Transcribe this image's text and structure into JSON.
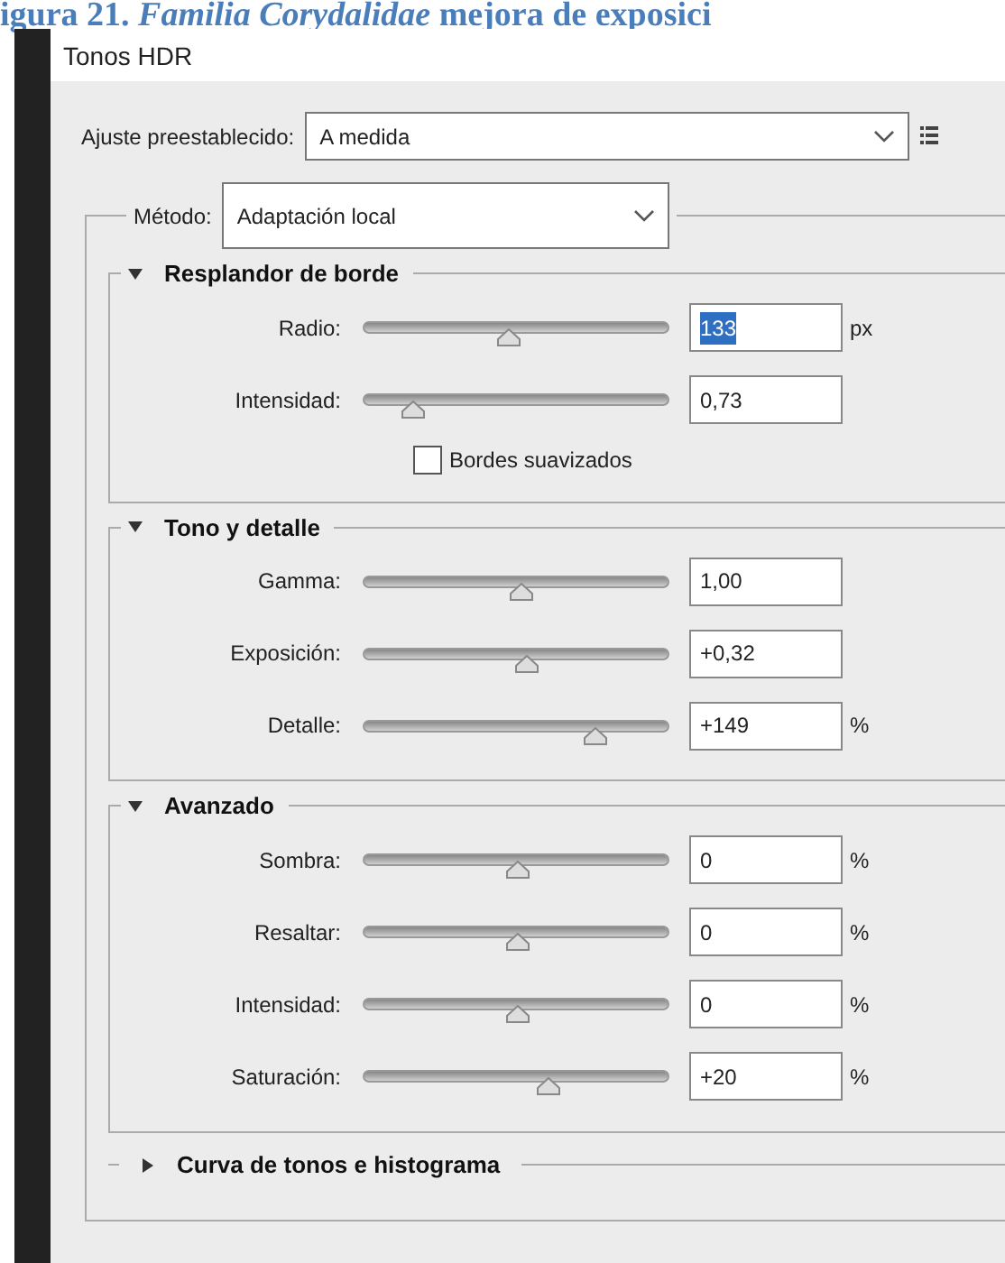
{
  "caption": "igura 21. *Familia Corydalidae* mejora de exposici",
  "window": {
    "title": "Tonos HDR"
  },
  "preset": {
    "label": "Ajuste preestablecido:",
    "value": "A medida"
  },
  "method": {
    "label": "Método:",
    "value": "Adaptación local"
  },
  "sections": [
    {
      "title": "Resplandor de borde",
      "expanded": true,
      "sliders": [
        {
          "label": "Radio:",
          "level": 0.47,
          "value": "133",
          "unit": "px",
          "selected": true
        },
        {
          "label": "Intensidad:",
          "level": 0.16,
          "value": "0,73",
          "selected": false
        }
      ],
      "checkbox": {
        "label": "Bordes suavizados",
        "checked": false
      }
    },
    {
      "title": "Tono y detalle",
      "expanded": true,
      "sliders": [
        {
          "label": "Gamma:",
          "level": 0.51,
          "value": "1,00",
          "selected": false
        },
        {
          "label": "Exposición:",
          "level": 0.53,
          "value": "+0,32",
          "selected": false
        },
        {
          "label": "Detalle:",
          "level": 0.75,
          "value": "+149",
          "unit": "%",
          "selected": false
        }
      ]
    },
    {
      "title": "Avanzado",
      "expanded": true,
      "sliders": [
        {
          "label": "Sombra:",
          "level": 0.5,
          "value": "0",
          "unit": "%",
          "selected": false
        },
        {
          "label": "Resaltar:",
          "level": 0.5,
          "value": "0",
          "unit": "%",
          "selected": false
        },
        {
          "label": "Intensidad:",
          "level": 0.5,
          "value": "0",
          "unit": "%",
          "selected": false
        },
        {
          "label": "Saturación:",
          "level": 0.6,
          "value": "+20",
          "unit": "%",
          "selected": false
        }
      ]
    },
    {
      "title": "Curva de tonos e histograma",
      "expanded": false
    }
  ]
}
